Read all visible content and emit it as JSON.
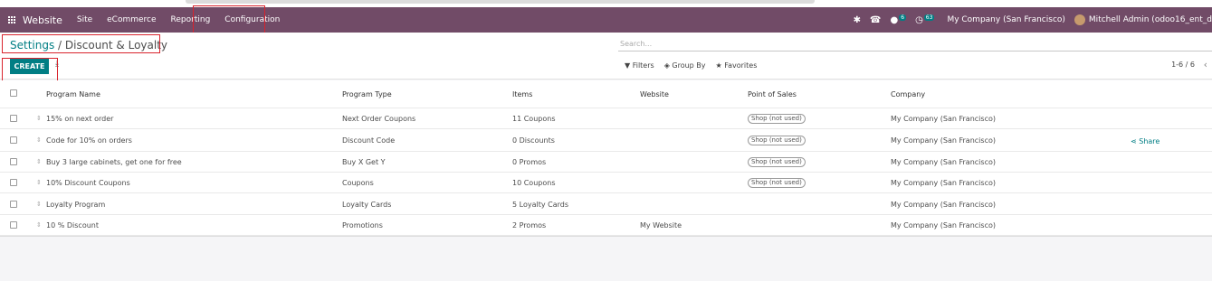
{
  "navbar": {
    "app_name": "Website",
    "menu": [
      "Site",
      "eCommerce",
      "Reporting",
      "Configuration"
    ],
    "messages_badge": "6",
    "activities_badge": "63",
    "company": "My Company (San Francisco)",
    "user": "Mitchell Admin (odoo16_ent_d"
  },
  "breadcrumb": {
    "parent": "Settings",
    "separator": "/",
    "current": "Discount & Loyalty"
  },
  "actions": {
    "create_label": "CREATE"
  },
  "search": {
    "placeholder": "Search..."
  },
  "filters": {
    "filters_label": "Filters",
    "group_by_label": "Group By",
    "favorites_label": "Favorites"
  },
  "pager": {
    "text": "1-6 / 6"
  },
  "table": {
    "columns": [
      "Program Name",
      "Program Type",
      "Items",
      "Website",
      "Point of Sales",
      "Company"
    ],
    "rows": [
      {
        "name": "15% on next order",
        "type": "Next Order Coupons",
        "items": "11 Coupons",
        "website": "",
        "pos": "Shop (not used)",
        "company": "My Company (San Francisco)",
        "extra": ""
      },
      {
        "name": "Code for 10% on orders",
        "type": "Discount Code",
        "items": "0 Discounts",
        "website": "",
        "pos": "Shop (not used)",
        "company": "My Company (San Francisco)",
        "extra": "Share"
      },
      {
        "name": "Buy 3 large cabinets, get one for free",
        "type": "Buy X Get Y",
        "items": "0 Promos",
        "website": "",
        "pos": "Shop (not used)",
        "company": "My Company (San Francisco)",
        "extra": ""
      },
      {
        "name": "10% Discount Coupons",
        "type": "Coupons",
        "items": "10 Coupons",
        "website": "",
        "pos": "Shop (not used)",
        "company": "My Company (San Francisco)",
        "extra": ""
      },
      {
        "name": "Loyalty Program",
        "type": "Loyalty Cards",
        "items": "5 Loyalty Cards",
        "website": "",
        "pos": "",
        "company": "My Company (San Francisco)",
        "extra": ""
      },
      {
        "name": "10 % Discount",
        "type": "Promotions",
        "items": "2 Promos",
        "website": "My Website",
        "pos": "",
        "company": "My Company (San Francisco)",
        "extra": ""
      }
    ]
  },
  "colors": {
    "navbar": "#714b67",
    "accent": "#017e84",
    "highlight_box": "#d9232d"
  },
  "icons": [
    "apps-grid-icon",
    "bug-icon",
    "phone-icon",
    "chat-icon",
    "clock-icon",
    "download-icon",
    "filter-icon",
    "layers-icon",
    "star-icon",
    "chevron-left-icon",
    "share-icon",
    "drag-handle-icon"
  ]
}
